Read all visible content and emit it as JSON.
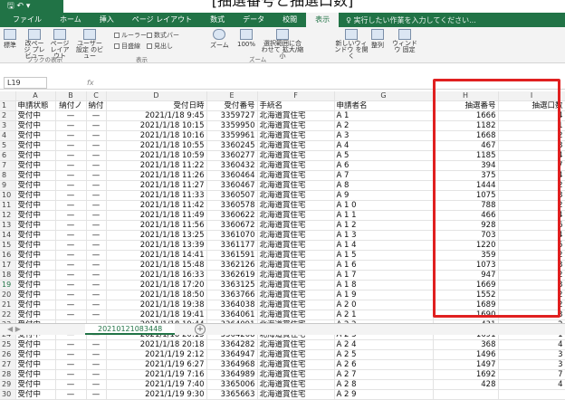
{
  "title": "[抽選番号と抽選口数]",
  "qat": "🖫 ↶ ▾",
  "tabs": [
    "ファイル",
    "ホーム",
    "挿入",
    "ページ レイアウト",
    "数式",
    "データ",
    "校閲",
    "表示"
  ],
  "active_tab_index": 7,
  "tell_me": "♀ 実行したい作業を入力してください...",
  "ribbon": {
    "normal": "標準",
    "page_break": "改ページ プレビュー",
    "page_layout": "ページ レイアウト",
    "custom_view": "ユーザー設定 のビュー",
    "ruler": "ルーラー",
    "formula_bar": "数式バー",
    "gridlines": "目盛線",
    "headings": "見出し",
    "zoom": "ズーム",
    "zoom100": "100%",
    "zoom_selection": "選択範囲に合わせて 拡大/縮小",
    "new_window": "新しいウィンドウ を開く",
    "arrange": "整列",
    "freeze": "ウィンドウ 固定",
    "group_views": "ブックの表示",
    "group_show": "表示",
    "group_zoom": "ズーム"
  },
  "name_box": "L19",
  "fx": "fx",
  "columns": [
    "",
    "A",
    "B",
    "C",
    "D",
    "E",
    "F",
    "G",
    "H",
    "I"
  ],
  "header_row": [
    "1",
    "申請状態",
    "納付ノ",
    "納付",
    "受付日時",
    "受付番号",
    "手続名",
    "申請者名",
    "抽選番号",
    "抽選口数"
  ],
  "rows": [
    [
      "2",
      "受付中",
      "—",
      "—",
      "2021/1/18 9:45",
      "3359727",
      "北海道賞住宅",
      "A 1",
      "1666",
      "4"
    ],
    [
      "3",
      "受付中",
      "—",
      "—",
      "2021/1/18 10:15",
      "3359950",
      "北海道賞住宅",
      "A 2",
      "1182",
      "1"
    ],
    [
      "4",
      "受付中",
      "—",
      "—",
      "2021/1/18 10:16",
      "3359961",
      "北海道賞住宅",
      "A 3",
      "1668",
      "2"
    ],
    [
      "5",
      "受付中",
      "—",
      "—",
      "2021/1/18 10:55",
      "3360245",
      "北海道賞住宅",
      "A 4",
      "467",
      "3"
    ],
    [
      "6",
      "受付中",
      "—",
      "—",
      "2021/1/18 10:59",
      "3360277",
      "北海道賞住宅",
      "A 5",
      "1185",
      "4"
    ],
    [
      "7",
      "受付中",
      "—",
      "—",
      "2021/1/18 11:22",
      "3360432",
      "北海道賞住宅",
      "A 6",
      "394",
      "7"
    ],
    [
      "8",
      "受付中",
      "—",
      "—",
      "2021/1/18 11:26",
      "3360464",
      "北海道賞住宅",
      "A 7",
      "375",
      "4"
    ],
    [
      "9",
      "受付中",
      "—",
      "—",
      "2021/1/18 11:27",
      "3360467",
      "北海道賞住宅",
      "A 8",
      "1444",
      "2"
    ],
    [
      "10",
      "受付中",
      "—",
      "—",
      "2021/1/18 11:33",
      "3360507",
      "北海道賞住宅",
      "A 9",
      "1075",
      "3"
    ],
    [
      "11",
      "受付中",
      "—",
      "—",
      "2021/1/18 11:42",
      "3360578",
      "北海道賞住宅",
      "A 1 0",
      "788",
      "2"
    ],
    [
      "12",
      "受付中",
      "—",
      "—",
      "2021/1/18 11:49",
      "3360622",
      "北海道賞住宅",
      "A 1 1",
      "466",
      "4"
    ],
    [
      "13",
      "受付中",
      "—",
      "—",
      "2021/1/18 11:56",
      "3360672",
      "北海道賞住宅",
      "A 1 2",
      "928",
      "6"
    ],
    [
      "14",
      "受付中",
      "—",
      "—",
      "2021/1/18 13:25",
      "3361070",
      "北海道賞住宅",
      "A 1 3",
      "703",
      "4"
    ],
    [
      "15",
      "受付中",
      "—",
      "—",
      "2021/1/18 13:39",
      "3361177",
      "北海道賞住宅",
      "A 1 4",
      "1220",
      "5"
    ],
    [
      "16",
      "受付中",
      "—",
      "—",
      "2021/1/18 14:41",
      "3361591",
      "北海道賞住宅",
      "A 1 5",
      "359",
      "2"
    ],
    [
      "17",
      "受付中",
      "—",
      "—",
      "2021/1/18 15:48",
      "3362126",
      "北海道賞住宅",
      "A 1 6",
      "1073",
      "3"
    ],
    [
      "18",
      "受付中",
      "—",
      "—",
      "2021/1/18 16:33",
      "3362619",
      "北海道賞住宅",
      "A 1 7",
      "947",
      "2"
    ],
    [
      "19",
      "受付中",
      "—",
      "—",
      "2021/1/18 17:20",
      "3363125",
      "北海道賞住宅",
      "A 1 8",
      "1669",
      "3"
    ],
    [
      "20",
      "受付中",
      "—",
      "—",
      "2021/1/18 18:50",
      "3363766",
      "北海道賞住宅",
      "A 1 9",
      "1552",
      "2"
    ],
    [
      "21",
      "受付中",
      "—",
      "—",
      "2021/1/18 19:38",
      "3364038",
      "北海道賞住宅",
      "A 2 0",
      "1689",
      "2"
    ],
    [
      "22",
      "受付中",
      "—",
      "—",
      "2021/1/18 19:41",
      "3364061",
      "北海道賞住宅",
      "A 2 1",
      "1690",
      "3"
    ],
    [
      "23",
      "受付中",
      "—",
      "—",
      "2021/1/18 19:44",
      "3364091",
      "北海道賞住宅",
      "A 2 2",
      "431",
      "2"
    ],
    [
      "24",
      "受付中",
      "—",
      "—",
      "2021/1/18 20:15",
      "3364268",
      "北海道賞住宅",
      "A 2 3",
      "1691",
      "1"
    ],
    [
      "25",
      "受付中",
      "—",
      "—",
      "2021/1/18 20:18",
      "3364282",
      "北海道賞住宅",
      "A 2 4",
      "368",
      "4"
    ],
    [
      "26",
      "受付中",
      "—",
      "—",
      "2021/1/19 2:12",
      "3364947",
      "北海道賞住宅",
      "A 2 5",
      "1496",
      "3"
    ],
    [
      "27",
      "受付中",
      "—",
      "—",
      "2021/1/19 6:27",
      "3364968",
      "北海道賞住宅",
      "A 2 6",
      "1497",
      "3"
    ],
    [
      "28",
      "受付中",
      "—",
      "—",
      "2021/1/19 7:16",
      "3364989",
      "北海道賞住宅",
      "A 2 7",
      "1692",
      "7"
    ],
    [
      "29",
      "受付中",
      "—",
      "—",
      "2021/1/19 7:40",
      "3365006",
      "北海道賞住宅",
      "A 2 8",
      "428",
      "4"
    ],
    [
      "30",
      "受付中",
      "—",
      "—",
      "2021/1/19 9:30",
      "3365663",
      "北海道賞住宅",
      "A 2 9",
      "",
      ""
    ]
  ],
  "selected_row": "19",
  "sheet_tab": "20210121083448",
  "sheet_add": "+",
  "sheet_nav": "◀ ▶",
  "highlight_color": "#e02020",
  "accent_color": "#217346"
}
